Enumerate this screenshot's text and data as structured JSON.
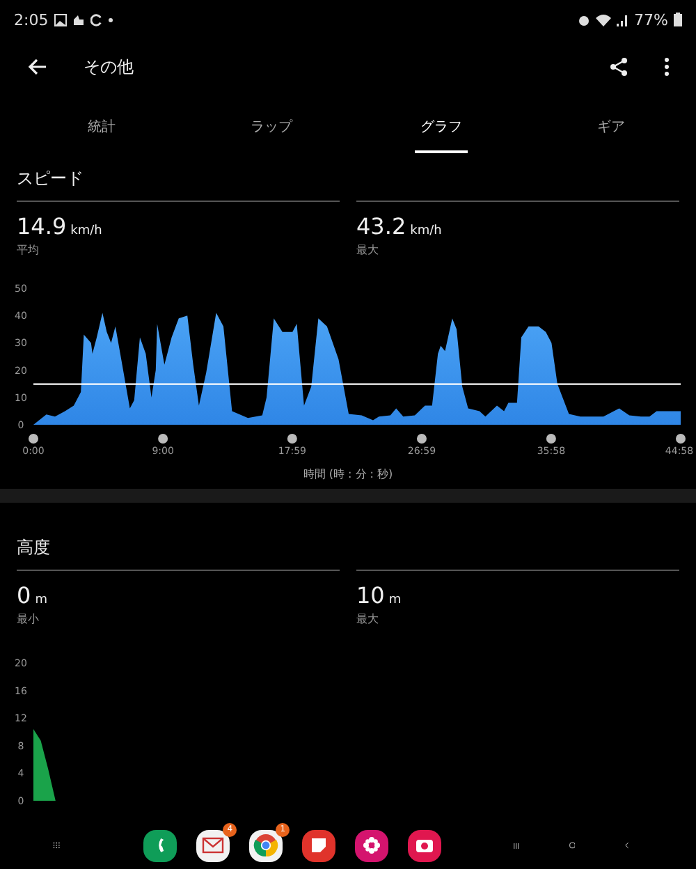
{
  "status_bar": {
    "time": "2:05",
    "battery": "77%"
  },
  "header": {
    "title": "その他"
  },
  "tabs": [
    {
      "label": "統計",
      "selected": false
    },
    {
      "label": "ラップ",
      "selected": false
    },
    {
      "label": "グラフ",
      "selected": true
    },
    {
      "label": "ギア",
      "selected": false
    }
  ],
  "sections": [
    {
      "title": "スピード",
      "stats": [
        {
          "value": "14.9",
          "unit": "km/h",
          "label": "平均"
        },
        {
          "value": "43.2",
          "unit": "km/h",
          "label": "最大"
        }
      ],
      "chart_data": {
        "type": "area",
        "xlim": [
          0,
          44.97
        ],
        "ylim": [
          0,
          50
        ],
        "yticks": [
          0,
          10,
          20,
          30,
          40,
          50
        ],
        "xticks": [
          {
            "value": 0,
            "label": "0:00"
          },
          {
            "value": 9,
            "label": "9:00"
          },
          {
            "value": 17.98,
            "label": "17:59"
          },
          {
            "value": 26.98,
            "label": "26:59"
          },
          {
            "value": 35.97,
            "label": "35:58"
          },
          {
            "value": 44.97,
            "label": "44:58"
          }
        ],
        "xlabel": "時間 (時 : 分 : 秒)",
        "ref_lines": [
          {
            "value": 14.9,
            "axis": "y",
            "color": "#ffffff"
          }
        ],
        "series": [
          {
            "color": "#2f86e6",
            "x": [
              0,
              0.9,
              1.5,
              2.2,
              2.8,
              3.3,
              3.5,
              4.0,
              4.1,
              4.4,
              4.8,
              5.1,
              5.4,
              5.7,
              6.1,
              6.7,
              7.0,
              7.4,
              7.8,
              8.2,
              8.5,
              8.6,
              9.1,
              9.6,
              10.1,
              10.7,
              11.1,
              11.5,
              12.0,
              12.7,
              13.2,
              13.8,
              14.9,
              15.9,
              16.2,
              16.7,
              17.3,
              18.0,
              18.3,
              18.8,
              19.3,
              19.8,
              20.4,
              21.2,
              21.9,
              22.8,
              23.6,
              24.0,
              24.8,
              25.2,
              25.7,
              26.5,
              27.2,
              27.7,
              28.1,
              28.3,
              28.6,
              29.1,
              29.4,
              29.8,
              30.2,
              31.0,
              31.4,
              32.2,
              32.7,
              33.0,
              33.6,
              33.9,
              34.4,
              35.1,
              35.6,
              36.0,
              36.4,
              37.2,
              38.0,
              39.6,
              40.7,
              41.4,
              42.2,
              42.8,
              43.3,
              44.1,
              44.97
            ],
            "values": [
              0,
              3.8,
              3,
              5,
              7,
              12,
              33,
              30,
              26,
              32,
              41,
              34,
              30,
              36,
              24,
              6,
              9,
              32,
              26,
              10,
              20,
              37,
              22,
              32,
              39,
              40,
              22,
              7,
              19,
              41,
              36,
              5,
              2.5,
              3.4,
              10,
              39,
              34,
              34,
              37,
              7,
              14,
              39,
              36,
              24,
              4,
              3.4,
              1.7,
              3,
              3.4,
              6,
              3,
              3.4,
              7,
              7,
              26,
              29,
              27,
              39,
              35,
              14,
              6,
              5,
              3,
              7,
              5,
              8,
              8,
              32,
              36,
              36,
              34,
              30,
              15,
              4,
              3,
              3,
              6,
              3.4,
              3,
              3,
              5,
              5,
              5
            ]
          }
        ]
      }
    },
    {
      "title": "高度",
      "stats": [
        {
          "value": "0",
          "unit": "m",
          "label": "最小"
        },
        {
          "value": "10",
          "unit": "m",
          "label": "最大"
        }
      ],
      "chart_data": {
        "type": "area",
        "ylim": [
          0,
          20
        ],
        "yticks": [
          0,
          4,
          8,
          12,
          16,
          20
        ],
        "categories": [
          null,
          null,
          null,
          null
        ],
        "series": [
          {
            "color": "#1aa34a",
            "values": [
              10.4,
              8.7,
              4.6,
              0
            ]
          }
        ]
      }
    }
  ],
  "dock": {
    "apps": [
      {
        "kind": "phone"
      },
      {
        "kind": "mail",
        "badge": "4"
      },
      {
        "kind": "browser",
        "badge": "1"
      },
      {
        "kind": "notes"
      },
      {
        "kind": "flower"
      },
      {
        "kind": "camera"
      }
    ]
  }
}
